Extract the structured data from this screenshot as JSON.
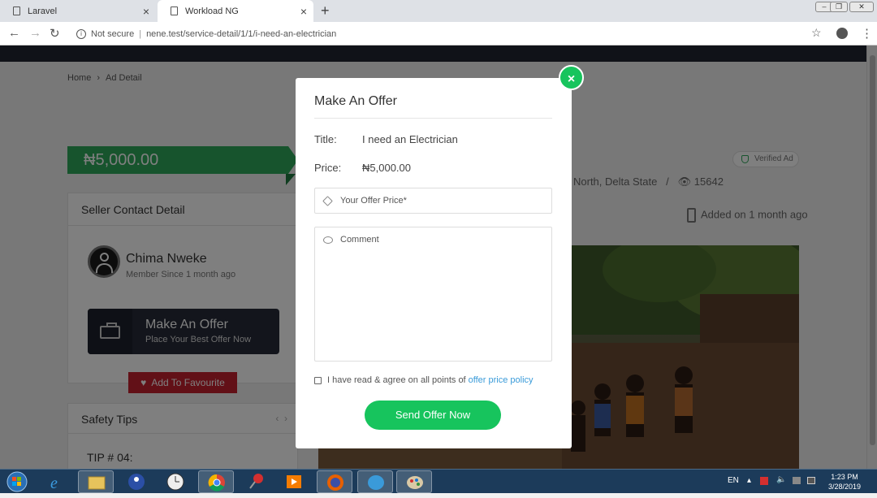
{
  "browser": {
    "tabs": [
      {
        "label": "Laravel"
      },
      {
        "label": "Workload NG"
      }
    ],
    "new_tab": "+",
    "url_security": "Not secure",
    "url": "nene.test/service-detail/1/1/i-need-an-electrician"
  },
  "page": {
    "breadcrumb": {
      "home": "Home",
      "current": "Ad Detail"
    },
    "price_banner": "₦5,000.00",
    "seller_card": {
      "title": "Seller Contact Detail",
      "name": "Chima Nweke",
      "member_since": "Member Since 1 month ago",
      "offer_button_title": "Make An Offer",
      "offer_button_sub": "Place Your Best Offer Now",
      "favourite_button": "Add To Favourite"
    },
    "safety": {
      "title": "Safety Tips",
      "tip": "TIP # 04:"
    },
    "verified_badge": "Verified Ad",
    "location_meta": {
      "location": "North, Delta State",
      "separator": "/",
      "views": "15642"
    },
    "added": "Added on 1 month ago"
  },
  "modal": {
    "title": "Make An Offer",
    "title_label": "Title:",
    "title_value": "I need an Electrician",
    "price_label": "Price:",
    "price_value": "₦5,000.00",
    "offer_placeholder": "Your Offer Price*",
    "comment_placeholder": "Comment",
    "agree_text": "I have read & agree on all points of",
    "agree_link": "offer price policy",
    "send_button": "Send Offer Now",
    "close": "×"
  },
  "taskbar": {
    "lang": "EN",
    "time": "1:23 PM",
    "date": "3/28/2019"
  },
  "colors": {
    "brand_green": "#17c45d",
    "banner_green": "#2ea85a",
    "fav_red": "#c4202f",
    "dark_nav": "#202430",
    "link_blue": "#3a9bd9"
  }
}
